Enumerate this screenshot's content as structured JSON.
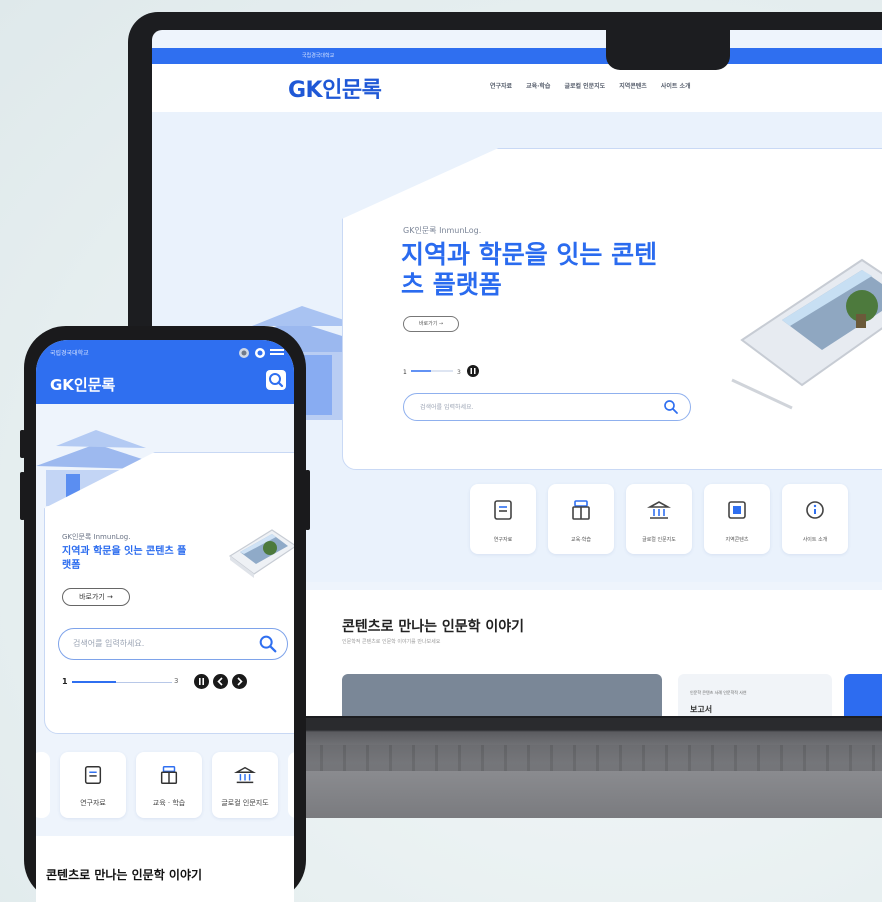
{
  "laptop": {
    "topbar_text": "국립경국대학교",
    "logo": "GK인문록",
    "nav": [
      "연구자료",
      "교육·학습",
      "글로컬 인문지도",
      "지역콘텐츠",
      "사이트 소개"
    ],
    "hero": {
      "eyebrow": "GK인문록 InmunLog.",
      "headline": "지역과 학문을 잇는 콘텐츠 플랫폼",
      "button": "바로가기 →",
      "search_placeholder": "검색어를 입력하세요."
    },
    "icon_cards": [
      {
        "label": "연구자료",
        "icon": "document-icon"
      },
      {
        "label": "교육·학습",
        "icon": "book-icon"
      },
      {
        "label": "글로컬 인문지도",
        "icon": "museum-icon"
      },
      {
        "label": "지역콘텐츠",
        "icon": "media-icon"
      },
      {
        "label": "사이트 소개",
        "icon": "info-icon"
      }
    ],
    "section": {
      "title": "콘텐츠로 만나는 인문학 이야기",
      "subtitle": "인문학적 콘텐츠로 인문학 이야기를 만나보세요",
      "card2_small": "인문학 콘텐츠 사례 인문학적 사연",
      "card2_title": "보고서"
    }
  },
  "phone": {
    "status": "국립경국대학교",
    "logo": "GK인문록",
    "hero": {
      "eyebrow": "GK인문록 InmunLog.",
      "headline": "지역과 학문을 잇는 콘텐츠 플랫폼",
      "button": "바로가기 →",
      "search_placeholder": "검색어를 입력하세요.",
      "pager_current": "1",
      "pager_total": "3"
    },
    "icon_cards": [
      {
        "label": "연구자료",
        "icon": "document-icon"
      },
      {
        "label": "교육 · 학습",
        "icon": "book-icon"
      },
      {
        "label": "글로컬 인문지도",
        "icon": "museum-icon"
      }
    ],
    "section_title": "콘텐츠로 만나는 인문학 이야기"
  },
  "colors": {
    "brand_blue": "#2f6ff0",
    "headline_blue": "#2a6bef",
    "background": "#eef4fc"
  }
}
